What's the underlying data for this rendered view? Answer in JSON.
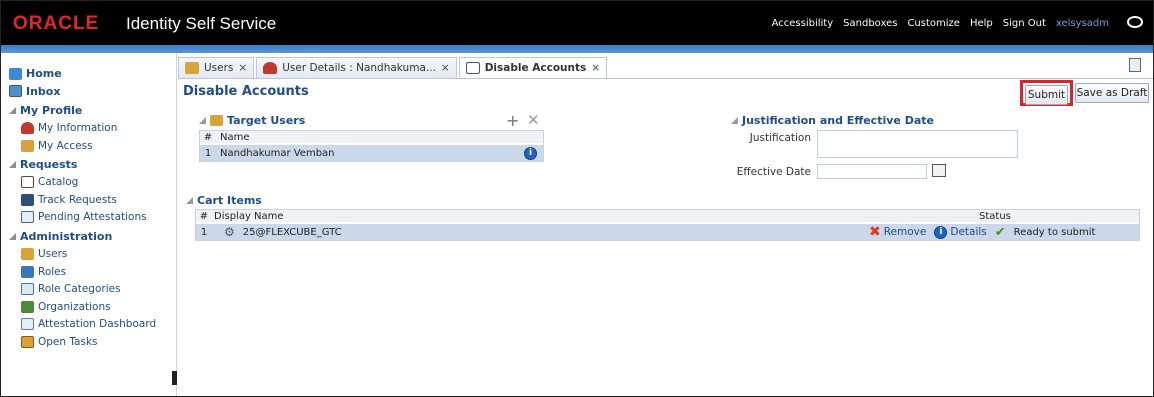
{
  "header": {
    "logo_text": "ORACLE",
    "app_title": "Identity Self Service",
    "links": [
      "Accessibility",
      "Sandboxes",
      "Customize",
      "Help",
      "Sign Out"
    ],
    "username": "xelsysadm"
  },
  "sidebar": {
    "home": "Home",
    "inbox": "Inbox",
    "my_profile": {
      "title": "My Profile",
      "items": [
        "My Information",
        "My Access"
      ]
    },
    "requests": {
      "title": "Requests",
      "items": [
        "Catalog",
        "Track Requests",
        "Pending Attestations"
      ]
    },
    "administration": {
      "title": "Administration",
      "items": [
        "Users",
        "Roles",
        "Role Categories",
        "Organizations",
        "Attestation Dashboard",
        "Open Tasks"
      ]
    }
  },
  "tabs": [
    {
      "label": "Users",
      "close": "×"
    },
    {
      "label": "User Details : Nandhakuma...",
      "close": "×"
    },
    {
      "label": "Disable Accounts",
      "close": "×"
    }
  ],
  "page": {
    "title": "Disable Accounts",
    "submit_label": "Submit",
    "draft_label": "Save as Draft"
  },
  "target_users": {
    "title": "Target Users",
    "col_num": "#",
    "col_name": "Name",
    "rows": [
      {
        "num": "1",
        "name": "Nandhakumar Vemban"
      }
    ]
  },
  "justification": {
    "title": "Justification and Effective Date",
    "justification_label": "Justification",
    "justification_value": "",
    "effective_date_label": "Effective Date",
    "effective_date_value": ""
  },
  "cart": {
    "title": "Cart Items",
    "col_num": "#",
    "col_display_name": "Display Name",
    "col_status": "Status",
    "rows": [
      {
        "num": "1",
        "display_name": "25@FLEXCUBE_GTC",
        "remove_label": "Remove",
        "details_label": "Details",
        "status": "Ready to submit"
      }
    ]
  },
  "colors": {
    "brand_red": "#e2262b",
    "nav_blue": "#1f4d8a",
    "row_selected": "#cad8ea",
    "highlight_red": "#e0202a"
  }
}
